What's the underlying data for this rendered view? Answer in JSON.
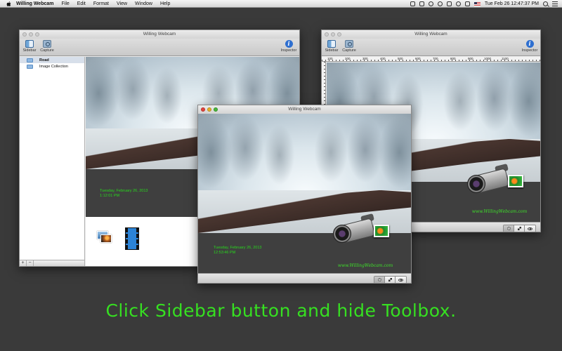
{
  "menubar": {
    "app_name": "Willing Webcam",
    "items": [
      "File",
      "Edit",
      "Format",
      "View",
      "Window",
      "Help"
    ],
    "clock": "Tue Feb 26  12:47:37 PM"
  },
  "left_window": {
    "title": "Willing Webcam",
    "toolbar": {
      "sidebar_label": "Sidebar",
      "capture_label": "Capture",
      "inspector_label": "Inspector"
    },
    "sidebar_items": [
      {
        "label": "Road",
        "selected": true
      },
      {
        "label": "Image Collection",
        "selected": false
      }
    ],
    "add_label": "+",
    "remove_label": "−",
    "stamp_date": "Tuesday, February 26, 2013",
    "stamp_time": "1:12:01 PM"
  },
  "right_window": {
    "title": "Willing Webcam",
    "toolbar": {
      "sidebar_label": "Sidebar",
      "capture_label": "Capture",
      "inspector_label": "Inspector"
    },
    "ruler_ticks": [
      "100",
      "200",
      "300",
      "400",
      "500",
      "600",
      "700",
      "800",
      "900",
      "1000",
      "1100"
    ],
    "brand_text": "www.WillingWebcam.com"
  },
  "front_window": {
    "title": "Willing Webcam",
    "stamp_date": "Tuesday, February 26, 2013",
    "stamp_time": "12:53:46 PM",
    "brand_text": "www.WillingWebcam.com"
  },
  "caption": "Click Sidebar button and hide Toolbox.",
  "colors": {
    "accent_green": "#36e021",
    "stamp_green": "#27d81d",
    "desktop": "#3a3a3a"
  }
}
